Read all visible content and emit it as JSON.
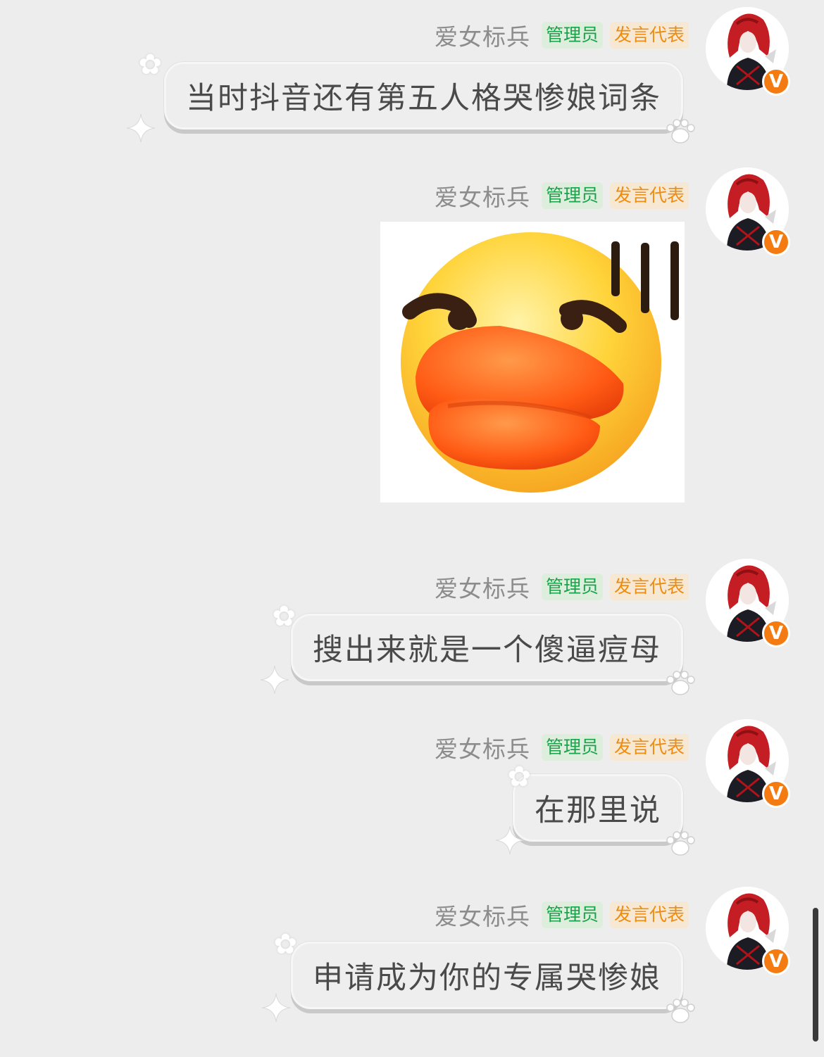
{
  "messages": [
    {
      "sender": "爱女标兵",
      "badges": {
        "admin": "管理员",
        "rep": "发言代表"
      },
      "verified_mark": "V",
      "text": "当时抖音还有第五人格哭惨娘词条"
    },
    {
      "sender": "爱女标兵",
      "badges": {
        "admin": "管理员",
        "rep": "发言代表"
      },
      "verified_mark": "V",
      "sticker": "duck-face-emoji"
    },
    {
      "sender": "爱女标兵",
      "badges": {
        "admin": "管理员",
        "rep": "发言代表"
      },
      "verified_mark": "V",
      "text": "搜出来就是一个傻逼痘母"
    },
    {
      "sender": "爱女标兵",
      "badges": {
        "admin": "管理员",
        "rep": "发言代表"
      },
      "verified_mark": "V",
      "text": "在那里说"
    },
    {
      "sender": "爱女标兵",
      "badges": {
        "admin": "管理员",
        "rep": "发言代表"
      },
      "verified_mark": "V",
      "text": "申请成为你的专属哭惨娘"
    }
  ],
  "colors": {
    "background": "#ededed",
    "admin_badge_text": "#1aa34a",
    "rep_badge_text": "#ef8c10",
    "verified_badge": "#f47a12"
  },
  "icons": [
    "verified-badge-icon",
    "star-decoration-icon",
    "sparkle-decoration-icon",
    "paw-decoration-icon"
  ]
}
